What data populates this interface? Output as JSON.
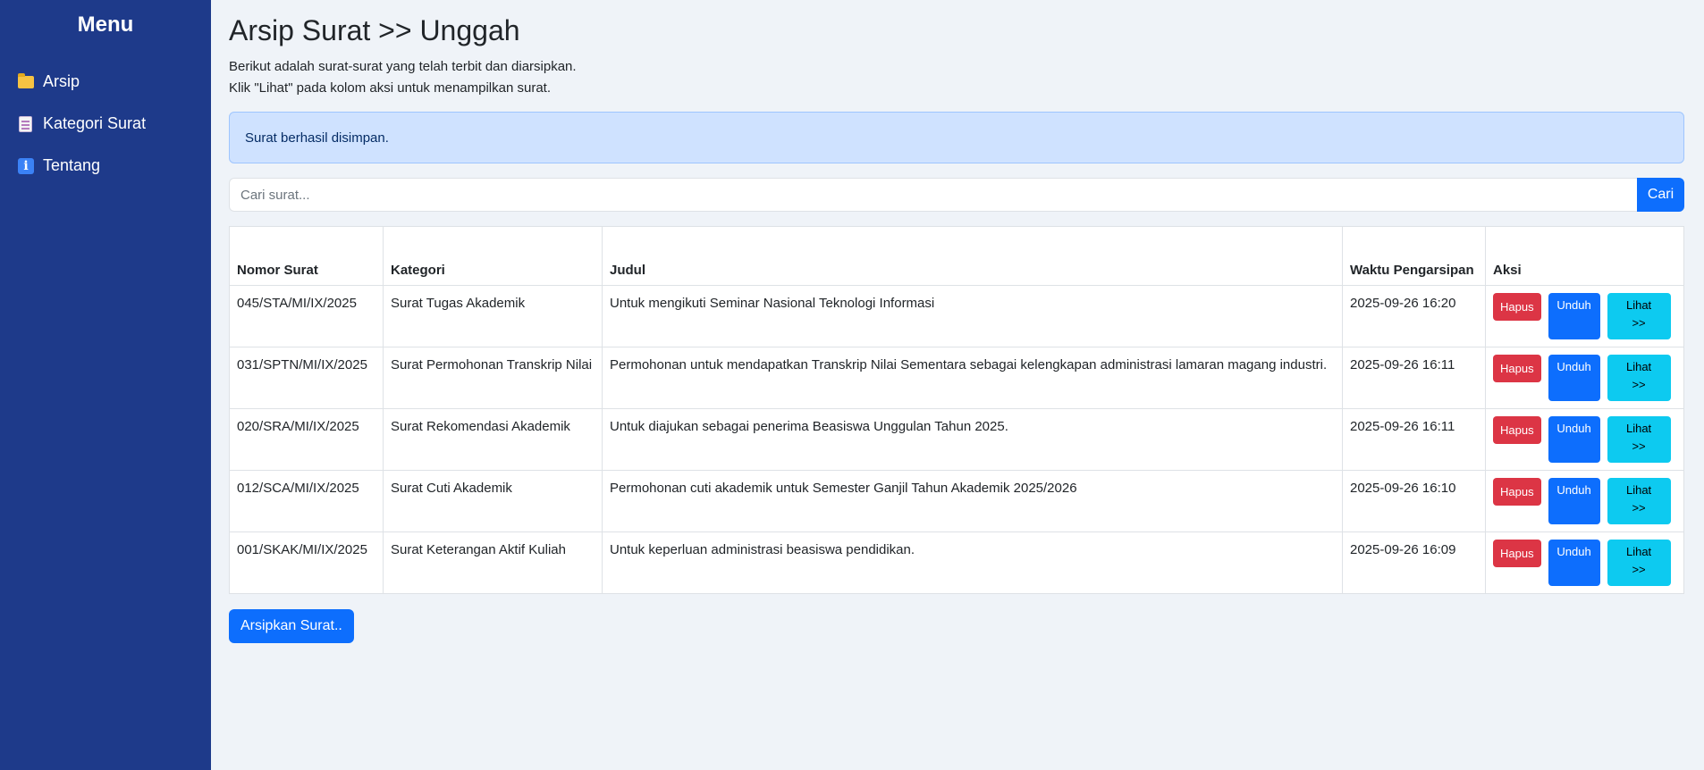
{
  "sidebar": {
    "title": "Menu",
    "items": [
      {
        "label": "Arsip",
        "icon": "folder-icon"
      },
      {
        "label": "Kategori Surat",
        "icon": "document-icon"
      },
      {
        "label": "Tentang",
        "icon": "info-icon"
      }
    ]
  },
  "header": {
    "title": "Arsip Surat >> Unggah",
    "desc_line1": "Berikut adalah surat-surat yang telah terbit dan diarsipkan.",
    "desc_line2": "Klik \"Lihat\" pada kolom aksi untuk menampilkan surat."
  },
  "alert": {
    "text": "Surat berhasil disimpan."
  },
  "search": {
    "placeholder": "Cari surat...",
    "value": "",
    "button_label": "Cari"
  },
  "table": {
    "headers": [
      "Nomor Surat",
      "Kategori",
      "Judul",
      "Waktu Pengarsipan",
      "Aksi"
    ],
    "rows": [
      {
        "nomor": "045/STA/MI/IX/2025",
        "kategori": "Surat Tugas Akademik",
        "judul": "Untuk mengikuti Seminar Nasional Teknologi Informasi",
        "waktu": "2025-09-26 16:20"
      },
      {
        "nomor": "031/SPTN/MI/IX/2025",
        "kategori": "Surat Permohonan Transkrip Nilai",
        "judul": "Permohonan untuk mendapatkan Transkrip Nilai Sementara sebagai kelengkapan administrasi lamaran magang industri.",
        "waktu": "2025-09-26 16:11"
      },
      {
        "nomor": "020/SRA/MI/IX/2025",
        "kategori": "Surat Rekomendasi Akademik",
        "judul": "Untuk diajukan sebagai penerima Beasiswa Unggulan Tahun 2025.",
        "waktu": "2025-09-26 16:11"
      },
      {
        "nomor": "012/SCA/MI/IX/2025",
        "kategori": "Surat Cuti Akademik",
        "judul": "Permohonan cuti akademik untuk Semester Ganjil Tahun Akademik 2025/2026",
        "waktu": "2025-09-26 16:10"
      },
      {
        "nomor": "001/SKAK/MI/IX/2025",
        "kategori": "Surat Keterangan Aktif Kuliah",
        "judul": "Untuk keperluan administrasi beasiswa pendidikan.",
        "waktu": "2025-09-26 16:09"
      }
    ],
    "actions": {
      "hapus": "Hapus",
      "unduh": "Unduh",
      "lihat_line1": "Lihat",
      "lihat_line2": ">>"
    }
  },
  "footer": {
    "archive_button": "Arsipkan Surat.."
  },
  "colors": {
    "sidebar_bg": "#1e3a8a",
    "page_bg": "#eff3f8",
    "primary": "#0d6efd",
    "danger": "#dc3545",
    "info": "#0dcaf0",
    "alert_bg": "#cfe2ff"
  }
}
